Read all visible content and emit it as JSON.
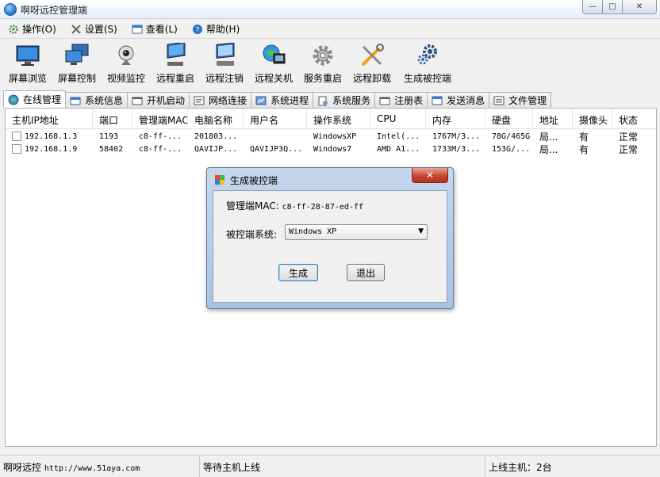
{
  "window": {
    "title": "啊呀远控管理端",
    "controls": {
      "minimize": "—",
      "maximize": "□",
      "close": "✕"
    }
  },
  "menu": [
    {
      "label": "操作(O)",
      "icon": "gear-icon"
    },
    {
      "label": "设置(S)",
      "icon": "tools-icon"
    },
    {
      "label": "查看(L)",
      "icon": "view-icon"
    },
    {
      "label": "帮助(H)",
      "icon": "help-icon"
    }
  ],
  "toolbar": [
    {
      "label": "屏幕浏览",
      "icon": "monitor-icon"
    },
    {
      "label": "屏幕控制",
      "icon": "monitors-icon"
    },
    {
      "label": "视频监控",
      "icon": "webcam-icon"
    },
    {
      "label": "远程重启",
      "icon": "restart-icon"
    },
    {
      "label": "远程注销",
      "icon": "logoff-icon"
    },
    {
      "label": "远程关机",
      "icon": "shutdown-icon"
    },
    {
      "label": "服务重启",
      "icon": "service-gear-icon"
    },
    {
      "label": "远程卸载",
      "icon": "uninstall-tools-icon"
    },
    {
      "label": "生成被控端",
      "icon": "build-gears-icon"
    }
  ],
  "tabs": [
    {
      "label": "在线管理",
      "active": true
    },
    {
      "label": "系统信息"
    },
    {
      "label": "开机启动"
    },
    {
      "label": "网络连接"
    },
    {
      "label": "系统进程"
    },
    {
      "label": "系统服务"
    },
    {
      "label": "注册表"
    },
    {
      "label": "发送消息"
    },
    {
      "label": "文件管理"
    }
  ],
  "table": {
    "columns": [
      "主机IP地址",
      "端口",
      "管理端MAC",
      "电脑名称",
      "用户名",
      "操作系统",
      "CPU",
      "内存",
      "硬盘",
      "地址",
      "摄像头",
      "状态"
    ],
    "rows": [
      [
        "192.168.1.3",
        "1193",
        "c8-ff-...",
        "201803...",
        "",
        "WindowsXP",
        "Intel(...",
        "1767M/3...",
        "78G/465G",
        "局...",
        "有",
        "正常"
      ],
      [
        "192.168.1.9",
        "58402",
        "c8-ff-...",
        "QAVIJP...",
        "QAVIJP3Q...",
        "Windows7",
        "AMD A1...",
        "1733M/3...",
        "153G/...",
        "局...",
        "有",
        "正常"
      ]
    ]
  },
  "status": {
    "brand": "啊呀远控",
    "url": "http://www.51aya.com",
    "message": "等待主机上线",
    "online": "上线主机：2台"
  },
  "dialog": {
    "title": "生成被控端",
    "close": "✕",
    "mac_label": "管理端MAC:",
    "mac_value": "c8-ff-28-87-ed-ff",
    "os_label": "被控端系统:",
    "os_value": "Windows XP",
    "generate_button": "生成",
    "exit_button": "退出"
  },
  "colors": {
    "dialog_frame": "#aac2e2",
    "close_red": "#c8452f",
    "accent_blue": "#1e6ec8"
  }
}
